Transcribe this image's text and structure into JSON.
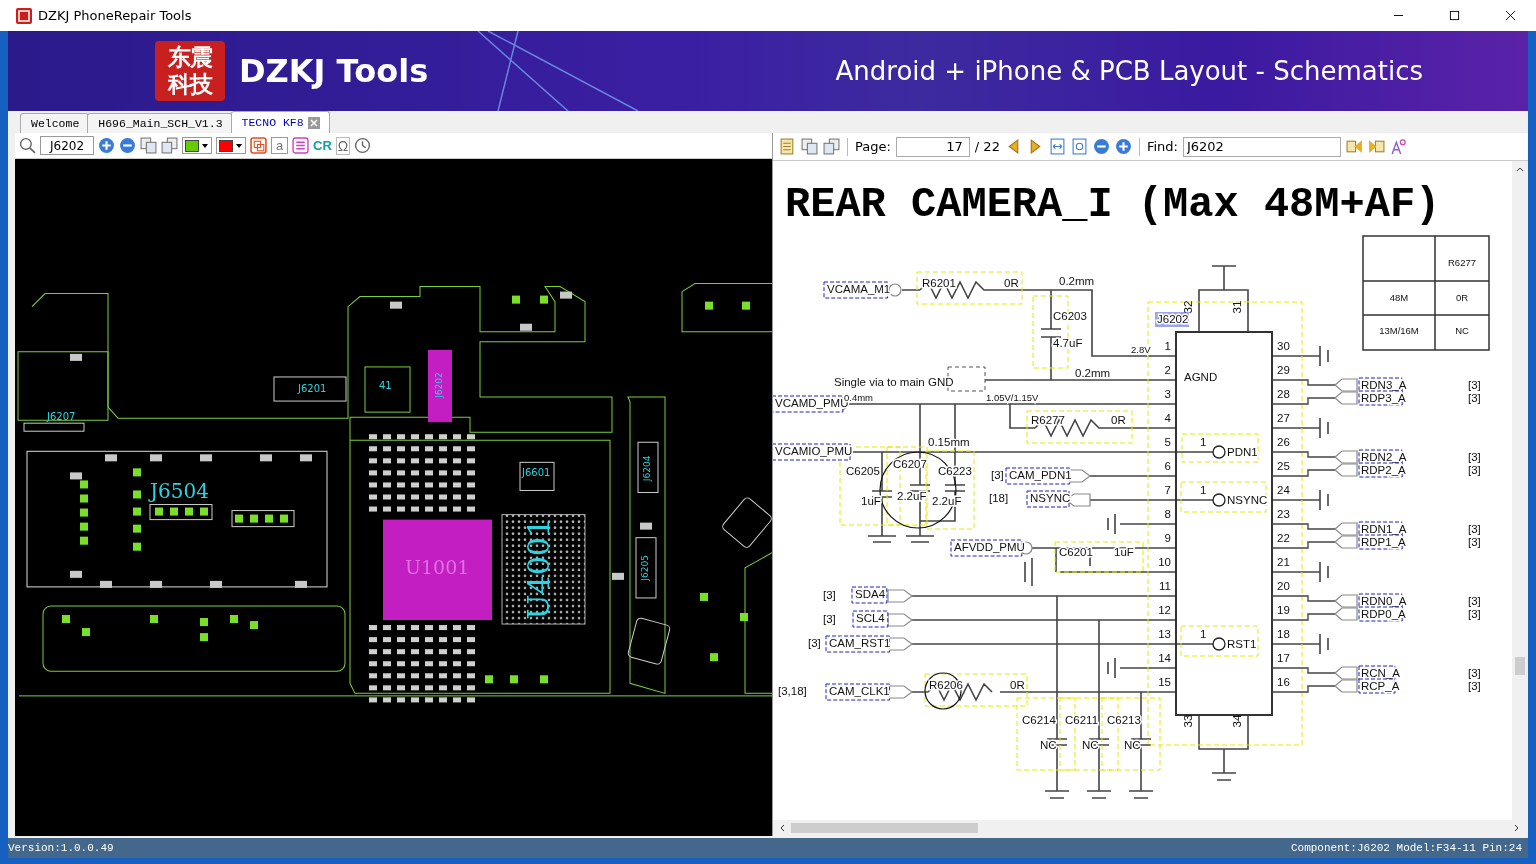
{
  "window": {
    "title": "DZKJ PhoneRepair Tools"
  },
  "banner": {
    "logo": [
      "东震",
      "科技"
    ],
    "brand": "DZKJ Tools",
    "tagline": "Android + iPhone & PCB Layout - Schematics"
  },
  "tabs": [
    {
      "label": "Welcome",
      "selected": false,
      "closable": false
    },
    {
      "label": "H696_Main_SCH_V1.3",
      "selected": false,
      "closable": false
    },
    {
      "label": "TECNO KF8",
      "selected": true,
      "closable": true
    }
  ],
  "pcb_toolbar": {
    "search": "J6202",
    "color_pickers": [
      {
        "color": "#66cc00"
      },
      {
        "color": "#ff0000"
      }
    ],
    "letter_button": "a",
    "cr_button": "CR",
    "omega_button": "Ω"
  },
  "pcb": {
    "labels": [
      {
        "text": "J6504",
        "kind": "large"
      },
      {
        "text": "U1001",
        "kind": "chip"
      },
      {
        "text": "U4001",
        "kind": "vertical-large"
      },
      {
        "text": "J6201",
        "kind": "small"
      },
      {
        "text": "J6207",
        "kind": "small"
      },
      {
        "text": "J6601",
        "kind": "small"
      },
      {
        "text": "J6202",
        "kind": "vertical-small"
      },
      {
        "text": "J6204",
        "kind": "vertical-small"
      },
      {
        "text": "J6205",
        "kind": "vertical-small"
      },
      {
        "text": "41",
        "kind": "small"
      }
    ]
  },
  "pdf_toolbar": {
    "page_label": "Page:",
    "page": "17",
    "page_total": "/ 22",
    "find_label": "Find:",
    "find": "J6202"
  },
  "schematic": {
    "title": "REAR CAMERA_I (Max 48M+AF)",
    "labels": [
      {
        "text": "VCAMA_M1",
        "kind": "net"
      },
      {
        "text": "R6201",
        "kind": "text"
      },
      {
        "text": "0R",
        "kind": "text"
      },
      {
        "text": "0.2mm",
        "kind": "text"
      },
      {
        "text": "C6203",
        "kind": "text"
      },
      {
        "text": "4.7uF",
        "kind": "text"
      },
      {
        "text": "2.8V",
        "kind": "small"
      },
      {
        "text": "0.2mm",
        "kind": "text"
      },
      {
        "text": "Single via to main GND",
        "kind": "text"
      },
      {
        "text": "VCAMD_PMU",
        "kind": "net"
      },
      {
        "text": "0.4mm",
        "kind": "small"
      },
      {
        "text": "1.05V/1.15V",
        "kind": "small"
      },
      {
        "text": "R6277",
        "kind": "text"
      },
      {
        "text": "0R",
        "kind": "text"
      },
      {
        "text": "VCAMIO_PMU",
        "kind": "net"
      },
      {
        "text": "0.15mm",
        "kind": "text"
      },
      {
        "text": "C6205",
        "kind": "text"
      },
      {
        "text": "1uF",
        "kind": "text"
      },
      {
        "text": "C6207",
        "kind": "text"
      },
      {
        "text": "2.2uF",
        "kind": "text"
      },
      {
        "text": "C6223",
        "kind": "text"
      },
      {
        "text": "2.2uF",
        "kind": "text"
      },
      {
        "text": "[3]",
        "kind": "text"
      },
      {
        "text": "CAM_PDN1",
        "kind": "net"
      },
      {
        "text": "[18]",
        "kind": "text"
      },
      {
        "text": "NSYNC",
        "kind": "net"
      },
      {
        "text": "AFVDD_PMU",
        "kind": "net"
      },
      {
        "text": "C6201",
        "kind": "text"
      },
      {
        "text": "1uF",
        "kind": "text"
      },
      {
        "text": "[3]",
        "kind": "text"
      },
      {
        "text": "SDA4",
        "kind": "net"
      },
      {
        "text": "[3]",
        "kind": "text"
      },
      {
        "text": "SCL4",
        "kind": "net"
      },
      {
        "text": "[3]",
        "kind": "text"
      },
      {
        "text": "CAM_RST1",
        "kind": "net"
      },
      {
        "text": "[3,18]",
        "kind": "text"
      },
      {
        "text": "CAM_CLK1",
        "kind": "net"
      },
      {
        "text": "R6206",
        "kind": "text"
      },
      {
        "text": "0R",
        "kind": "text"
      },
      {
        "text": "C6214",
        "kind": "text"
      },
      {
        "text": "NC",
        "kind": "text"
      },
      {
        "text": "C6211",
        "kind": "text"
      },
      {
        "text": "NC",
        "kind": "text"
      },
      {
        "text": "C6213",
        "kind": "text"
      },
      {
        "text": "NC",
        "kind": "text"
      }
    ],
    "connector": {
      "ref": "J6202",
      "name": "AGND",
      "top_pins": [
        "32",
        "31"
      ],
      "bottom_pins": [
        "33",
        "34"
      ],
      "left_pins": [
        "1",
        "2",
        "3",
        "4",
        "5",
        "6",
        "7",
        "8",
        "9",
        "10",
        "11",
        "12",
        "13",
        "14",
        "15"
      ],
      "right_pins": [
        "30",
        "29",
        "28",
        "27",
        "26",
        "25",
        "24",
        "23",
        "22",
        "21",
        "20",
        "19",
        "18",
        "17",
        "16"
      ],
      "pads": [
        {
          "number": "1",
          "net": "PDN1"
        },
        {
          "number": "1",
          "net": "NSYNC"
        },
        {
          "number": "1",
          "net": "RST1"
        }
      ]
    },
    "right_nets": [
      {
        "name": "RDN3_A",
        "ref": "[3]"
      },
      {
        "name": "RDP3_A",
        "ref": "[3]"
      },
      {
        "name": "RDN2_A",
        "ref": "[3]"
      },
      {
        "name": "RDP2_A",
        "ref": "[3]"
      },
      {
        "name": "RDN1_A",
        "ref": "[3]"
      },
      {
        "name": "RDP1_A",
        "ref": "[3]"
      },
      {
        "name": "RDN0_A",
        "ref": "[3]"
      },
      {
        "name": "RDP0_A",
        "ref": "[3]"
      },
      {
        "name": "RCN_A",
        "ref": "[3]"
      },
      {
        "name": "RCP_A",
        "ref": "[3]"
      }
    ],
    "option_table": {
      "rows": [
        [
          "",
          "R6277"
        ],
        [
          "48M",
          "0R"
        ],
        [
          "13M/16M",
          "NC"
        ]
      ]
    }
  },
  "status_bar": {
    "version": "Version:1.0.0.49",
    "component": "Component:J6202 Model:F34-11 Pin:24"
  }
}
